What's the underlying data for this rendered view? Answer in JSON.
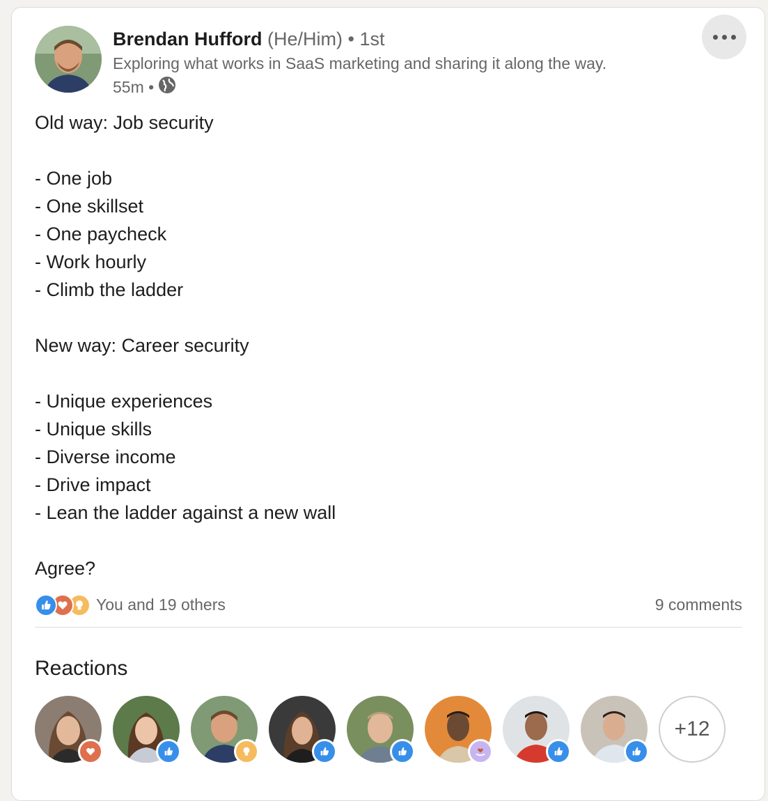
{
  "author": {
    "name": "Brendan Hufford",
    "pronouns": "(He/Him)",
    "connection": "• 1st",
    "headline": "Exploring what works in SaaS marketing and sharing it along the way.",
    "time": "55m •",
    "visibility_icon": "globe-icon"
  },
  "post": {
    "lines": [
      "Old way: Job security",
      "",
      "- One job",
      "- One skillset",
      "- One paycheck",
      "- Work hourly",
      "- Climb the ladder",
      "",
      "New way: Career security",
      "",
      "- Unique experiences",
      "- Unique skills",
      "- Diverse income",
      "- Drive impact",
      "- Lean the ladder against a new wall",
      "",
      "Agree?"
    ]
  },
  "social": {
    "reaction_types": [
      "like-icon",
      "love-icon",
      "insightful-icon"
    ],
    "reactions_label": "You and 19 others",
    "comments_label": "9 comments"
  },
  "reactions_section": {
    "title": "Reactions",
    "reactors": [
      {
        "reaction": "love-icon",
        "color": "#c86a4a"
      },
      {
        "reaction": "like-icon",
        "color": "#4a7ec2"
      },
      {
        "reaction": "insightful-icon",
        "color": "#e8a93b"
      },
      {
        "reaction": "like-icon",
        "color": "#4a7ec2"
      },
      {
        "reaction": "like-icon",
        "color": "#4a7ec2"
      },
      {
        "reaction": "support-icon",
        "color": "#a990d6"
      },
      {
        "reaction": "like-icon",
        "color": "#4a7ec2"
      },
      {
        "reaction": "like-icon",
        "color": "#4a7ec2"
      }
    ],
    "more_count": "+12"
  },
  "colors": {
    "like": "#378fe9",
    "love": "#df704d",
    "insightful": "#f5bb5c",
    "support": "#c7b5f0"
  }
}
